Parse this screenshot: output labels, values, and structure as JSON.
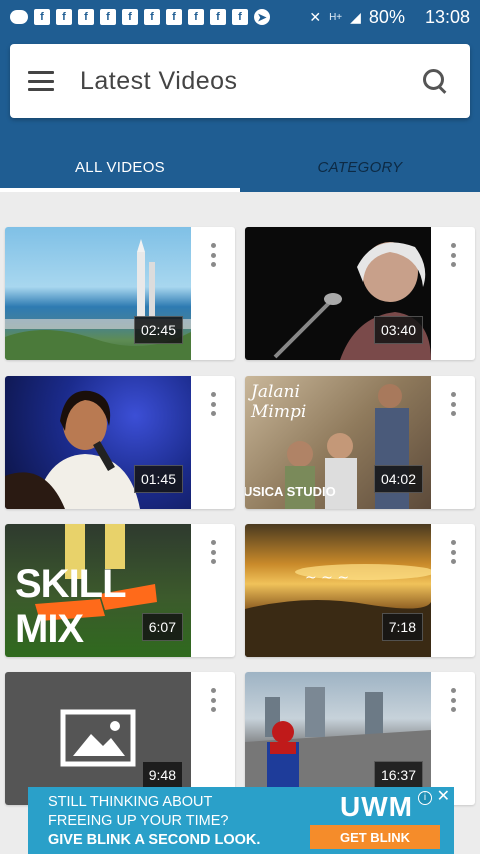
{
  "status_bar": {
    "battery": "80%",
    "time": "13:08",
    "network_label": "H+"
  },
  "header": {
    "title": "Latest Videos"
  },
  "tabs": [
    {
      "label": "ALL VIDEOS",
      "active": true
    },
    {
      "label": "CATEGORY",
      "active": false
    }
  ],
  "videos": [
    {
      "duration": "02:45"
    },
    {
      "duration": "03:40"
    },
    {
      "duration": "01:45"
    },
    {
      "duration": "04:02",
      "overlay_texts": [
        "Jalani",
        "Mimpi",
        "USICA STUDIO"
      ]
    },
    {
      "duration": "6:07",
      "overlay_texts": [
        "SKILL MIX"
      ]
    },
    {
      "duration": "7:18"
    },
    {
      "duration": "9:48"
    },
    {
      "duration": "16:37"
    }
  ],
  "ad": {
    "line1": "STILL THINKING ABOUT",
    "line2": "FREEING UP YOUR TIME?",
    "line3": "GIVE BLINK A SECOND LOOK.",
    "logo": "UWM",
    "cta": "GET BLINK",
    "colors": {
      "background": "#2aa0c9",
      "cta": "#f58c2a"
    }
  },
  "colors": {
    "primary": "#1f5d92",
    "background": "#ececec"
  }
}
